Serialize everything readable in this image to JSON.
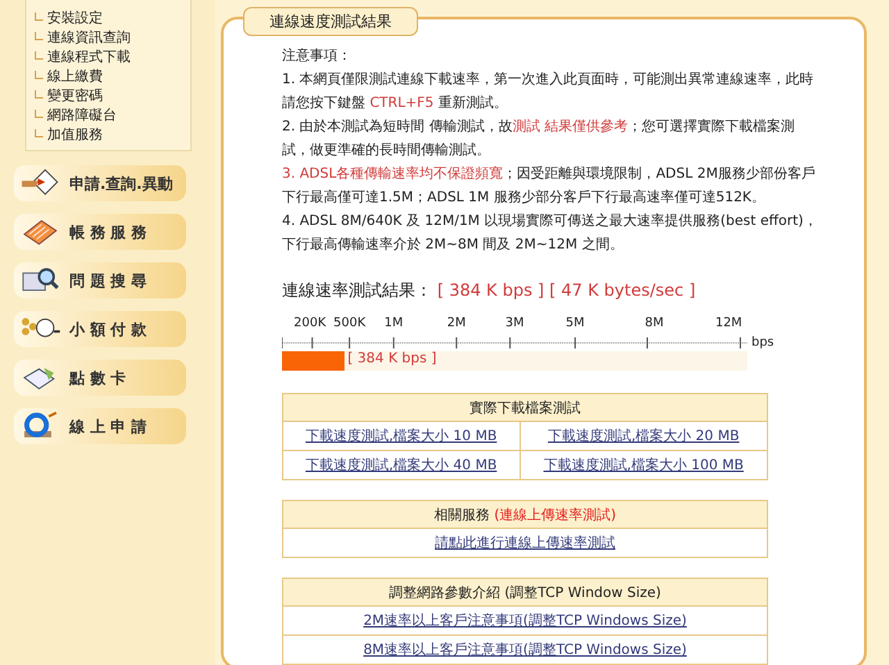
{
  "sidebar": {
    "links": [
      "安裝設定",
      "連線資訊查詢",
      "連線程式下載",
      "線上繳費",
      "變更密碼",
      "網路障礙台",
      "加值服務"
    ],
    "buttons": [
      {
        "label": "申請.查詢.異動",
        "kind": "form"
      },
      {
        "label": "帳 務 服 務",
        "kind": "ledger"
      },
      {
        "label": "問 題 搜 尋",
        "kind": "search"
      },
      {
        "label": "小 額 付 款",
        "kind": "coins"
      },
      {
        "label": "點 數 卡",
        "kind": "card"
      },
      {
        "label": "線 上 申 請",
        "kind": "browser"
      }
    ]
  },
  "panel": {
    "title": "連線速度測試結果",
    "notes_heading": "注意事項：",
    "notes": [
      [
        {
          "text": "1. 本網頁僅限測試連線下載速率，第一次進入此頁面時，可能測出異常連線速率，此時請您按下鍵盤 ",
          "emphasis": false
        },
        {
          "text": "CTRL+F5",
          "emphasis": true
        },
        {
          "text": " 重新測試。",
          "emphasis": false
        }
      ],
      [
        {
          "text": "2. 由於本測試為短時間 傳輸測試，故",
          "emphasis": false
        },
        {
          "text": "測試 結果僅供參考",
          "emphasis": true
        },
        {
          "text": "；您可選擇實際下載檔案測試，做更準確的長時間傳輸測試。",
          "emphasis": false
        }
      ],
      [
        {
          "text": "3. ADSL各種傳輸速率均不保證頻寬",
          "emphasis": true
        },
        {
          "text": "；因受距離與環境限制，ADSL 2M服務少部份客戶下行最高僅可達1.5M；ADSL 1M 服務少部分客戶下行最高速率僅可達512K。",
          "emphasis": false
        }
      ],
      [
        {
          "text": "4. ADSL 8M/640K 及 12M/1M 以現場實際可傳送之最大速率提供服務(best effort)，下行最高傳輸速率介於 2M~8M 間及 2M~12M 之間。",
          "emphasis": false
        }
      ]
    ],
    "result_label": "連線速率測試結果：",
    "result_bps": "[ 384 K bps ]",
    "result_bytes": "[ 47 K bytes/sec ]",
    "scale_ticks": [
      "200K",
      "500K",
      "1M",
      "2M",
      "3M",
      "5M",
      "8M",
      "12M"
    ],
    "scale_unit": "bps",
    "bar": {
      "level": 0.135,
      "reading": "[ 384 K bps ]"
    },
    "download_table": {
      "header": "實際下載檔案測試",
      "links": [
        "下載速度測試,檔案大小 10 MB",
        "下載速度測試,檔案大小 20 MB",
        "下載速度測試,檔案大小 40 MB",
        "下載速度測試,檔案大小 100 MB"
      ]
    },
    "related_table": {
      "header": "相關服務",
      "header_highlight": "(連線上傳速率測試)",
      "links": [
        "請點此進行連線上傳速率測試"
      ]
    },
    "tcp_table": {
      "header": "調整網路參數介紹 (調整TCP Window Size)",
      "links": [
        "2M速率以上客戶注意事項(調整TCP Windows Size)",
        "8M速率以上客戶注意事項(調整TCP Windows Size)"
      ]
    }
  }
}
